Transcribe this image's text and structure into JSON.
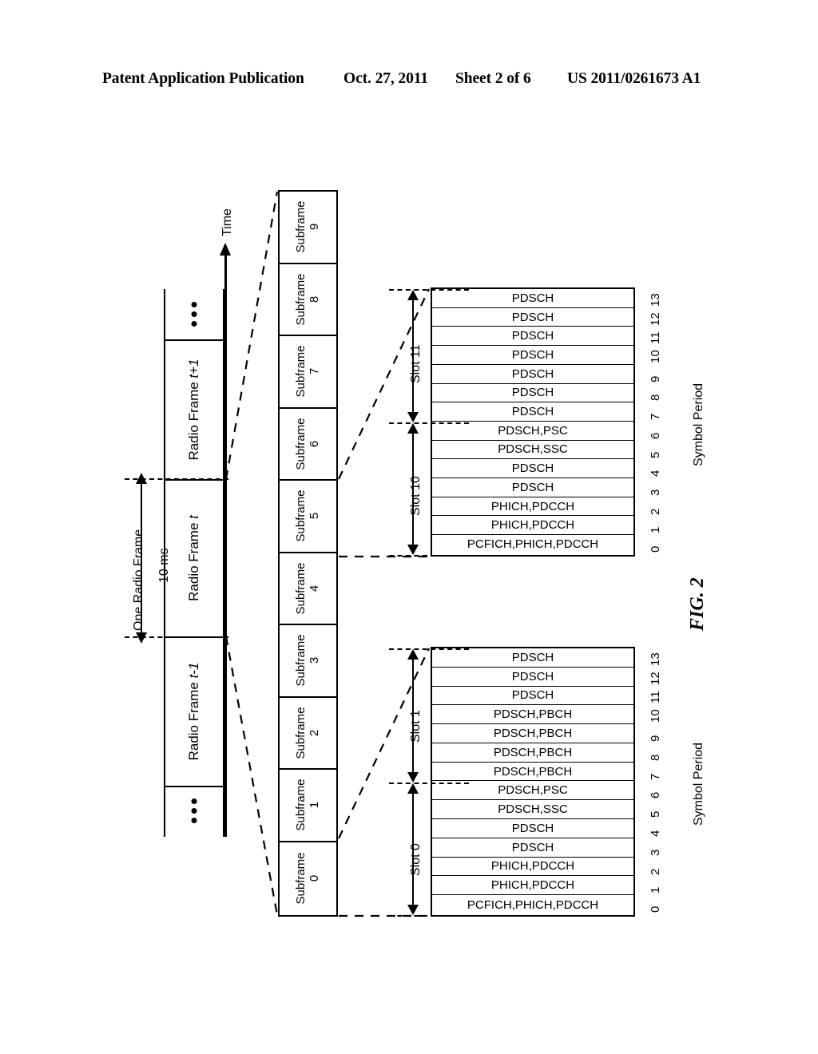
{
  "header": {
    "publication": "Patent Application Publication",
    "date": "Oct. 27, 2011",
    "sheet": "Sheet 2 of 6",
    "number": "US 2011/0261673 A1"
  },
  "figure": {
    "label": "FIG. 2",
    "time_axis_label": "Time",
    "one_radio_frame_label": "One Radio Frame",
    "one_radio_frame_duration": "10 ms",
    "symbol_period_title": "Symbol Period"
  },
  "radio_frames": {
    "ellipsis_glyph": "•••",
    "cells": [
      {
        "label_prefix": "Radio Frame ",
        "label_italic": "t+1"
      },
      {
        "label_prefix": "Radio Frame ",
        "label_italic": "t"
      },
      {
        "label_prefix": "Radio Frame ",
        "label_italic": "t-1"
      }
    ]
  },
  "subframes": {
    "word": "Subframe",
    "indices": [
      "9",
      "8",
      "7",
      "6",
      "5",
      "4",
      "3",
      "2",
      "1",
      "0"
    ]
  },
  "symbol_periods": [
    "13",
    "12",
    "11",
    "10",
    "9",
    "8",
    "7",
    "6",
    "5",
    "4",
    "3",
    "2",
    "1",
    "0"
  ],
  "upper_block": {
    "slots": [
      {
        "name": "Slot 11"
      },
      {
        "name": "Slot 10"
      }
    ],
    "rows": [
      "PDSCH",
      "PDSCH",
      "PDSCH",
      "PDSCH",
      "PDSCH",
      "PDSCH",
      "PDSCH",
      "PDSCH,PSC",
      "PDSCH,SSC",
      "PDSCH",
      "PDSCH",
      "PHICH,PDCCH",
      "PHICH,PDCCH",
      "PCFICH,PHICH,PDCCH"
    ]
  },
  "lower_block": {
    "slots": [
      {
        "name": "Slot 1"
      },
      {
        "name": "Slot 0"
      }
    ],
    "rows": [
      "PDSCH",
      "PDSCH",
      "PDSCH",
      "PDSCH,PBCH",
      "PDSCH,PBCH",
      "PDSCH,PBCH",
      "PDSCH,PBCH",
      "PDSCH,PSC",
      "PDSCH,SSC",
      "PDSCH",
      "PDSCH",
      "PHICH,PDCCH",
      "PHICH,PDCCH",
      "PCFICH,PHICH,PDCCH"
    ]
  }
}
